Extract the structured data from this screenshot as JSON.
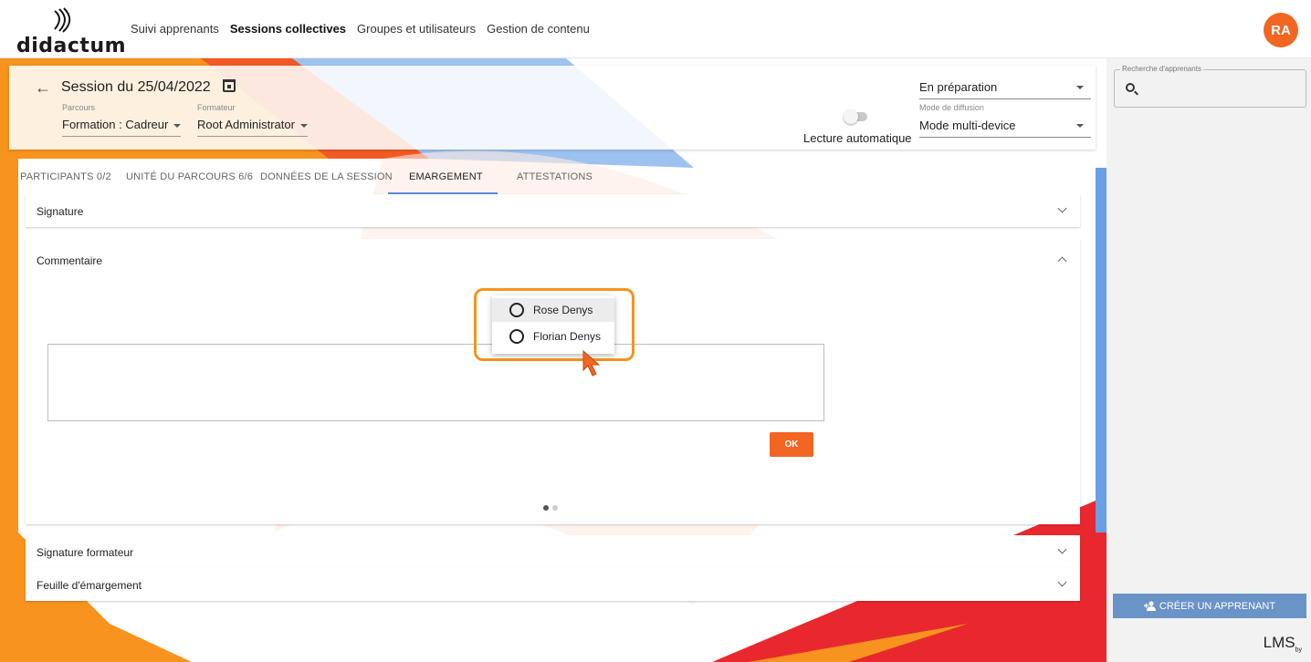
{
  "brand": {
    "name": "didactum"
  },
  "nav": [
    {
      "label": "Suivi apprenants",
      "active": false
    },
    {
      "label": "Sessions collectives",
      "active": true
    },
    {
      "label": "Groupes et utilisateurs",
      "active": false
    },
    {
      "label": "Gestion de contenu",
      "active": false
    }
  ],
  "user": {
    "initials": "RA"
  },
  "session": {
    "title": "Session du 25/04/2022",
    "parcours_label": "Parcours",
    "parcours_value": "Formation : Cadreur",
    "formateur_label": "Formateur",
    "formateur_value": "Root Administrator",
    "auto_play_label": "Lecture automatique",
    "status_value": "En préparation",
    "diffusion_label": "Mode de diffusion",
    "diffusion_value": "Mode multi-device"
  },
  "tabs": [
    {
      "label": "PARTICIPANTS 0/2"
    },
    {
      "label": "UNITÉ DU PARCOURS 6/6"
    },
    {
      "label": "DONNÉES DE LA SESSION"
    },
    {
      "label": "EMARGEMENT"
    },
    {
      "label": "ATTESTATIONS"
    }
  ],
  "panels": {
    "signature": "Signature",
    "commentaire": "Commentaire",
    "signature_formateur": "Signature formateur",
    "feuille": "Feuille d'émargement",
    "ok_label": "OK"
  },
  "popup": {
    "items": [
      {
        "label": "Rose Denys"
      },
      {
        "label": "Florian Denys"
      }
    ]
  },
  "sidebar": {
    "search_label": "Recherche d'apprenants",
    "create_button": "CRÉER UN APPRENANT",
    "footer": "LMS",
    "footer_sub": "by"
  }
}
